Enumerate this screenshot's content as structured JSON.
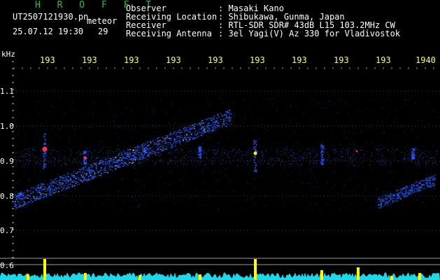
{
  "header": {
    "logo": "H R O F F T",
    "filename": "UT2507121930.pn",
    "tag": "meteor",
    "datetime": "25.07.12 19:30",
    "count": "29"
  },
  "info": [
    {
      "label": "Observer",
      "value": ":  Masaki Kano"
    },
    {
      "label": "Receiving Location",
      "value": ":  Shibukawa, Gunma, Japan"
    },
    {
      "label": "Receiver",
      "value": ":  RTL-SDR SDR# 43dB L15 103.2MHz CW"
    },
    {
      "label": "Receiving Antenna",
      "value": ":  3el Yagi(V) Az 330 for Vladivostok"
    }
  ],
  "axis": {
    "unit": "kHz",
    "y_ticks": [
      "1.1",
      "1.0",
      "0.9",
      "0.8",
      "0.7",
      "0.6"
    ],
    "x_ticks": [
      "193",
      "193",
      "193",
      "193",
      "193",
      "193",
      "193",
      "193",
      "193",
      "1940"
    ]
  },
  "colors": {
    "background": "#000000",
    "logo": "#26c431",
    "time_labels": "#ffff66",
    "signal": "#2a5bff",
    "amplitude": "#21d6e6",
    "peaks": "#ffff00"
  }
}
